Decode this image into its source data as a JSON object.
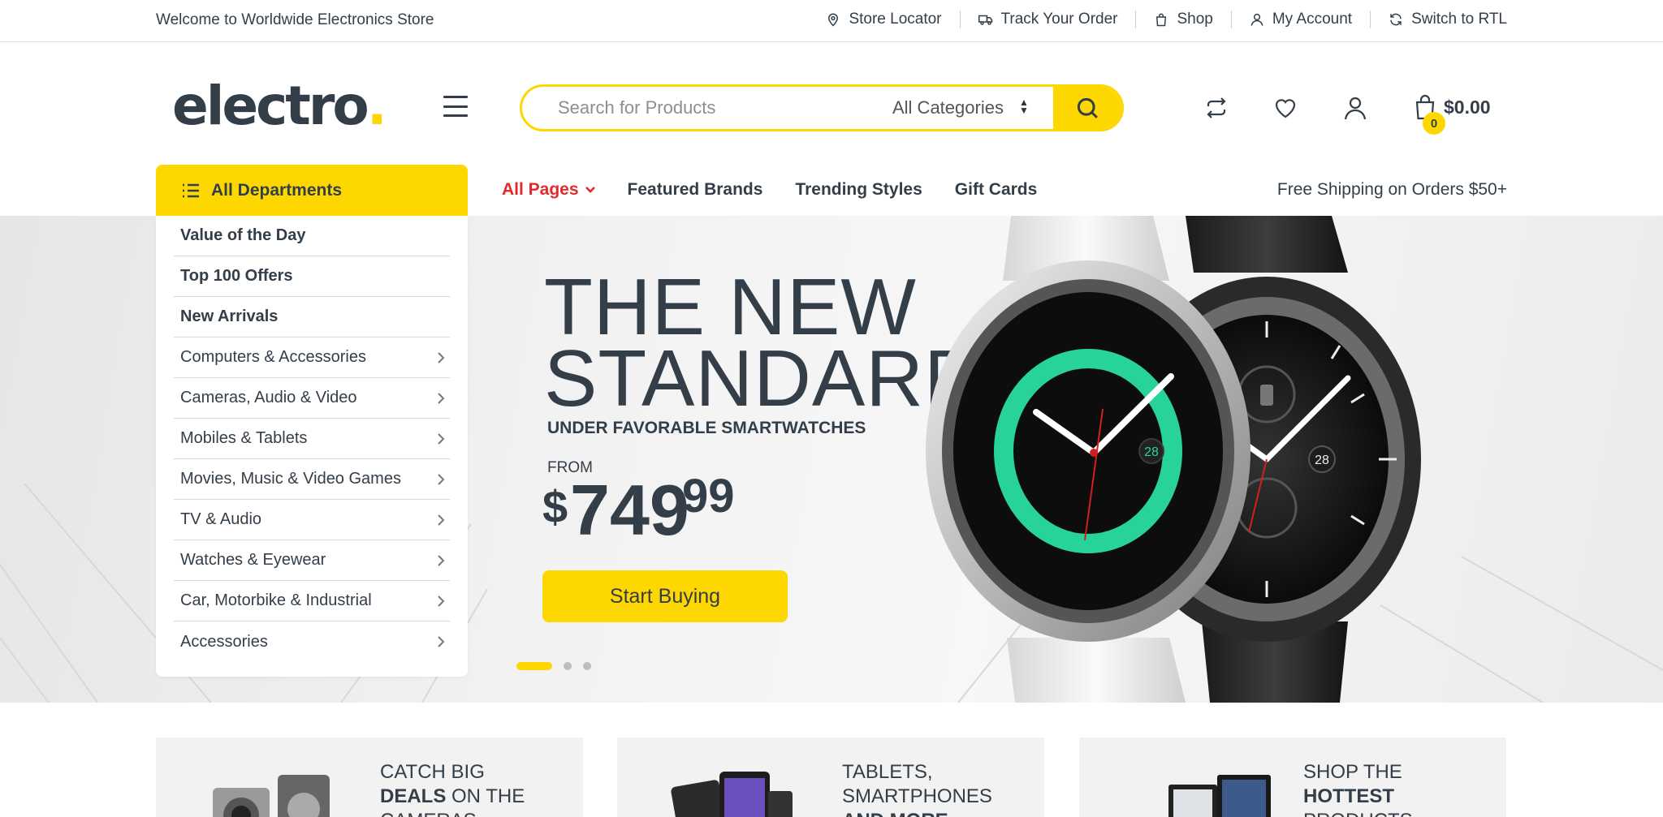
{
  "topbar": {
    "welcome": "Welcome to Worldwide Electronics Store",
    "links": {
      "store_locator": "Store Locator",
      "track_order": "Track Your Order",
      "shop": "Shop",
      "my_account": "My Account",
      "switch_rtl": "Switch to RTL"
    }
  },
  "header": {
    "logo_text": "electro",
    "logo_dot": ".",
    "search": {
      "placeholder": "Search for Products",
      "category": "All Categories"
    },
    "cart": {
      "count": "0",
      "amount": "$0.00"
    }
  },
  "nav": {
    "all_departments": "All Departments",
    "items": {
      "all_pages": "All Pages",
      "featured_brands": "Featured Brands",
      "trending_styles": "Trending Styles",
      "gift_cards": "Gift Cards"
    },
    "free_shipping": "Free Shipping on Orders $50+"
  },
  "departments": [
    "Value of the Day",
    "Top 100 Offers",
    "New Arrivals",
    "Computers & Accessories",
    "Cameras, Audio & Video",
    "Mobiles & Tablets",
    "Movies, Music & Video Games",
    "TV & Audio",
    "Watches & Eyewear",
    "Car, Motorbike & Industrial",
    "Accessories"
  ],
  "hero": {
    "title_line1": "THE NEW",
    "title_line2": "STANDARD",
    "subtitle": "UNDER FAVORABLE SMARTWATCHES",
    "from": "FROM",
    "price_currency": "$",
    "price_int": "749",
    "price_cents": "99",
    "cta": "Start Buying",
    "watch_date_left": "28",
    "watch_date_right": "28",
    "slide_count": 3,
    "active_slide": 1
  },
  "promos": [
    {
      "line1": "CATCH BIG",
      "bold": "DEALS",
      "rest": " ON THE",
      "line3": "CAMERAS"
    },
    {
      "line1": "TABLETS,",
      "line2": "SMARTPHONES",
      "bold": "AND MORE"
    },
    {
      "line1": "SHOP THE",
      "bold": "HOTTEST",
      "line3": "PRODUCTS"
    }
  ],
  "colors": {
    "accent": "#fed700",
    "text": "#333e48",
    "highlight": "#e12b2b"
  }
}
